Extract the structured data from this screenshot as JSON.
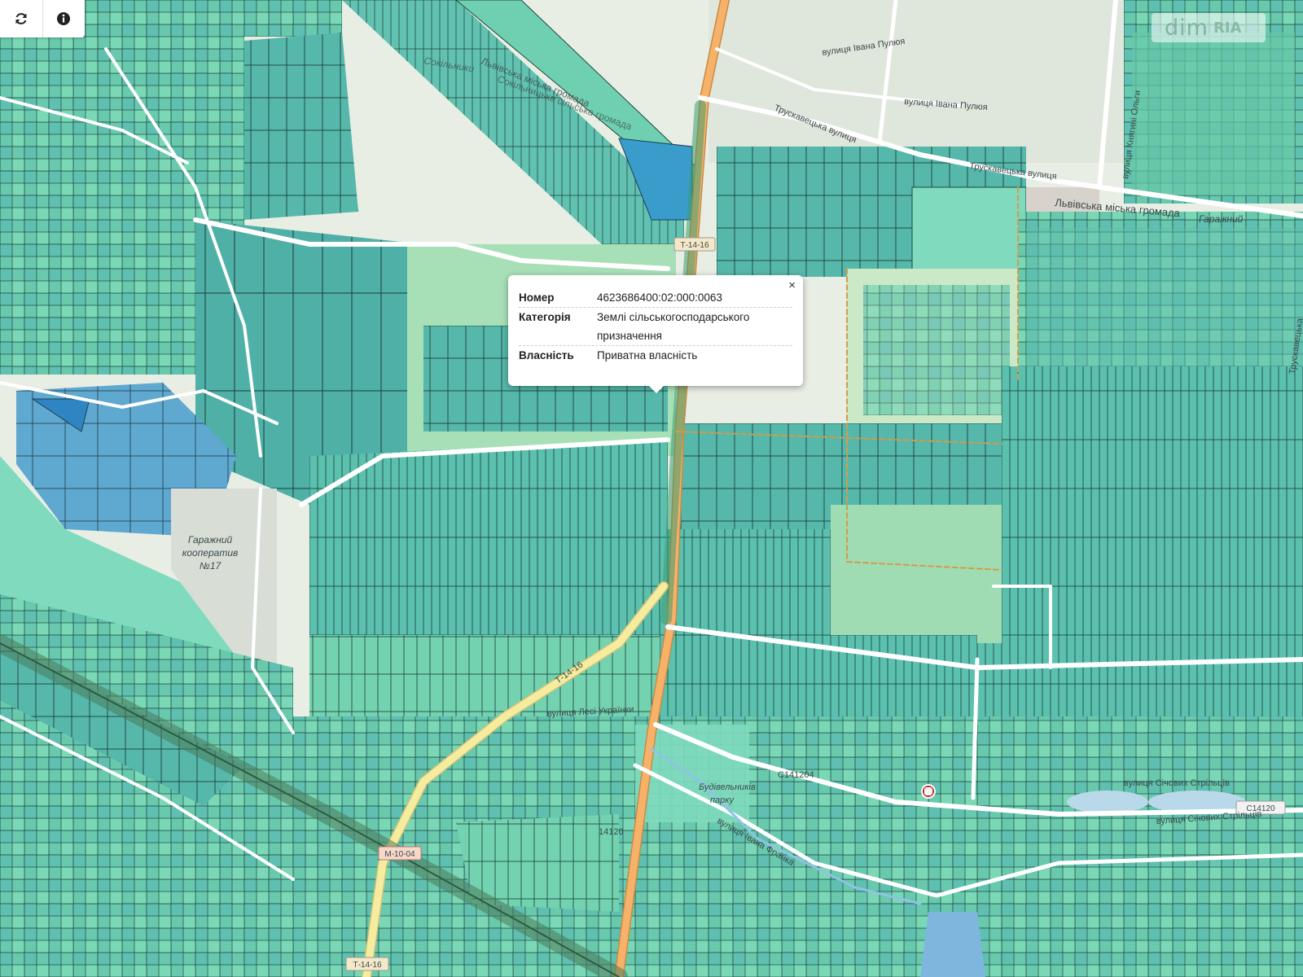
{
  "toolbar": {
    "refresh_icon": "refresh-icon",
    "info_icon": "info-icon"
  },
  "watermark": {
    "main": "dim",
    "sub": "RIA"
  },
  "popup": {
    "close_label": "×",
    "rows": [
      {
        "key": "Номер",
        "value": "4623686400:02:000:0063"
      },
      {
        "key": "Категорія",
        "value": "Землі сільськогосподарського призначення"
      },
      {
        "key": "Власність",
        "value": "Приватна власність"
      }
    ]
  },
  "map_labels": {
    "ivan_pulyuy_1": "вулиця Івана Пулюя",
    "ivan_pulyuy_2": "вулиця Івана Пулюя",
    "truskavetska_1": "Трускавецька вулиця",
    "truskavetska_2": "Трускавецька вулиця",
    "kniahyni_olhy": "вулиця Княгині Ольги",
    "lviv_hromada_1": "Львівська міська громада",
    "lviv_hromada_2": "Львівська міська громада",
    "sokilnyky": "Сокільники",
    "sokilnytska_hromada": "Сокільницька сільська громада",
    "garazhnyi_1": "Гаражний",
    "garazhnyi_2": "Гаражний",
    "kooperatyv": "кооператив",
    "no17": "№17",
    "lesi_ukrainky": "вулиця Лесі Українки",
    "sichovykh_striltsiv_1": "вулиця Січових Стрільців",
    "sichovykh_striltsiv_2": "вулиця Січових Стрільців",
    "ivana_franka": "вулиця Івана Франка",
    "budivelnykiv": "Будівельників",
    "park": "парку",
    "t1416_top": "Т-14-16",
    "t1416_mid": "Т-14-16",
    "t1416_bottom": "Т-14-16",
    "m10": "М-10-04",
    "c1412": "С141204",
    "c1412b": "С14120",
    "k_14120": "14120",
    "truskavetska_right": "Трускавецька"
  },
  "colors": {
    "parcel_green": "#6fd4b0",
    "parcel_teal": "#4fb4a6",
    "parcel_blue": "#5aa3cf",
    "road_orange": "#f5a55b",
    "road_yellow": "#f2e79a",
    "background": "#e9efe6"
  }
}
